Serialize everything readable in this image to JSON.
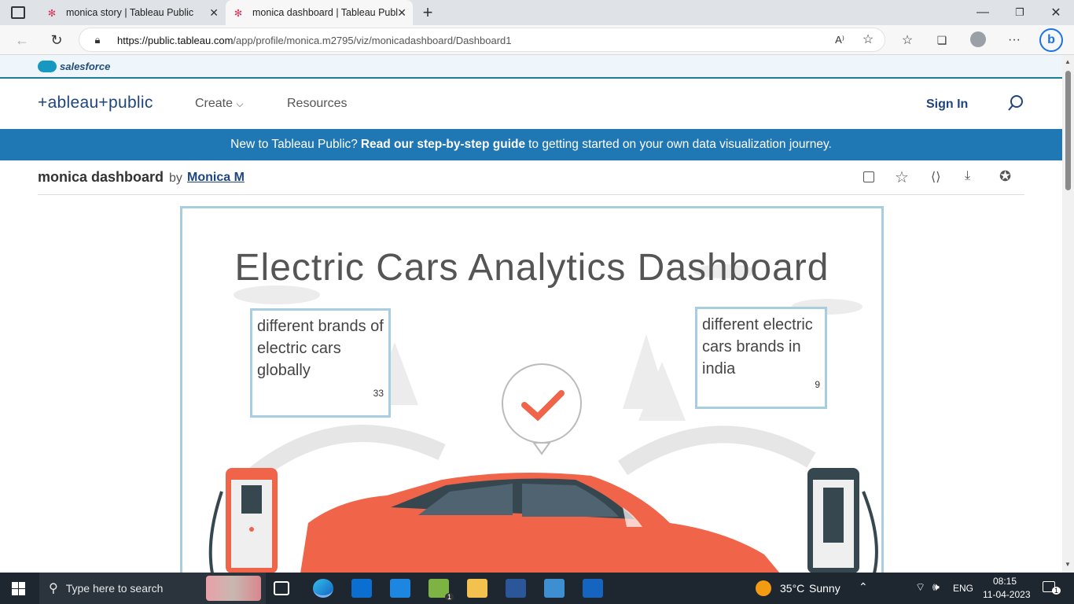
{
  "browser": {
    "tabs": [
      {
        "title": "monica story | Tableau Public"
      },
      {
        "title": "monica dashboard | Tableau Publ"
      }
    ],
    "url_host": "https://public.tableau.com",
    "url_path": "/app/profile/monica.m2795/viz/monicadashboard/Dashboard1"
  },
  "salesforce": {
    "label": "salesforce"
  },
  "nav": {
    "logo_text": "+ableau+public",
    "create_label": "Create",
    "resources_label": "Resources",
    "signin_label": "Sign In"
  },
  "banner": {
    "prefix": "New to Tableau Public?",
    "link": "Read our step-by-step guide",
    "suffix": "to getting started on your own data visualization journey."
  },
  "viz_header": {
    "title": "monica dashboard",
    "by": "by",
    "author": "Monica M"
  },
  "dashboard": {
    "title": "Electric Cars Analytics Dashboard",
    "kpis": [
      {
        "label": "different brands of electric cars globally",
        "value": "33"
      },
      {
        "label": "different electric cars brands in india",
        "value": "9"
      }
    ]
  },
  "taskbar": {
    "search_placeholder": "Type here to search",
    "weather_temp": "35°C",
    "weather_desc": "Sunny",
    "lang": "ENG",
    "time": "08:15",
    "date": "11-04-2023",
    "notif_count": "1",
    "app_badge": "1"
  },
  "colors": {
    "banner_bg": "#1f77b4",
    "tableau_blue": "#1f457e",
    "kpi_border": "#a9cde0",
    "car_orange": "#f0654a"
  }
}
